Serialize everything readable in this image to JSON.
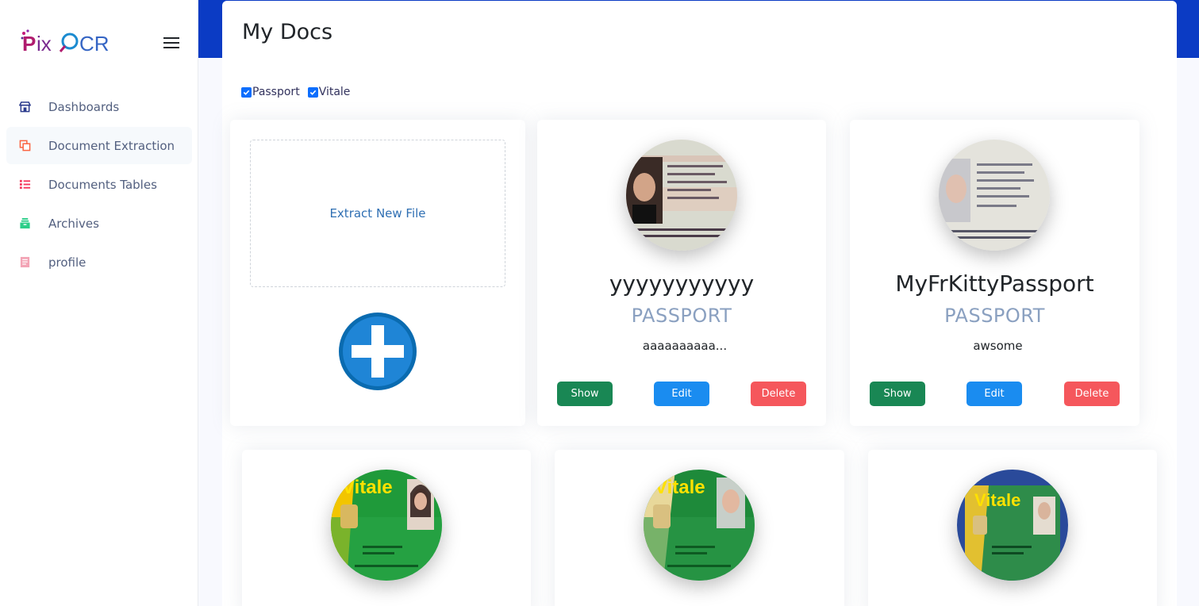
{
  "brand": {
    "name": "PixOCR",
    "prefix": "Pix",
    "suffix": "CR"
  },
  "sidebar": {
    "items": [
      {
        "label": "Dashboards",
        "icon": "shop-icon",
        "color": "#2a3a8c",
        "active": false
      },
      {
        "label": "Document Extraction",
        "icon": "copy-icon",
        "color": "#fb6340",
        "active": true
      },
      {
        "label": "Documents Tables",
        "icon": "list-icon",
        "color": "#f5365c",
        "active": false
      },
      {
        "label": "Archives",
        "icon": "archive-icon",
        "color": "#2dce89",
        "active": false
      },
      {
        "label": "profile",
        "icon": "document-icon",
        "color": "#f3a4b5",
        "active": false
      }
    ]
  },
  "page": {
    "title": "My Docs"
  },
  "filters": [
    {
      "label": "Passport",
      "checked": true
    },
    {
      "label": "Vitale",
      "checked": true
    }
  ],
  "upload": {
    "label": "Extract New File"
  },
  "actions": {
    "show": "Show",
    "edit": "Edit",
    "delete": "Delete"
  },
  "documents": [
    {
      "name": "yyyyyyyyyyy",
      "type": "PASSPORT",
      "description": "aaaaaaaaaa..."
    },
    {
      "name": "MyFrKittyPassport",
      "type": "PASSPORT",
      "description": "awsome"
    }
  ],
  "vitale_cards": [
    {
      "brand": "Vitale"
    },
    {
      "brand": "Vitale"
    },
    {
      "brand": "Vitale"
    }
  ]
}
